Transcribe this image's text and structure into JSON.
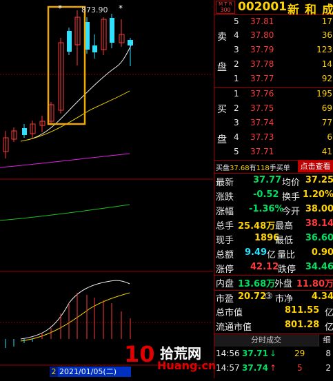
{
  "chart": {
    "high_label": "873.90",
    "star_marks": [
      "*",
      "*"
    ],
    "date_label": "2021/01/05(二)",
    "date_prefix": "2"
  },
  "header": {
    "logo_line1": "M T R",
    "logo_line2": "300",
    "code": "002001",
    "name": "新和成"
  },
  "sell": {
    "label_top": "卖",
    "label_bottom": "盘",
    "rows": [
      {
        "level": "5",
        "price": "37.81",
        "vol": "17"
      },
      {
        "level": "4",
        "price": "37.80",
        "vol": "36"
      },
      {
        "level": "3",
        "price": "37.79",
        "vol": "123"
      },
      {
        "level": "2",
        "price": "37.78",
        "vol": "14"
      },
      {
        "level": "1",
        "price": "37.77",
        "vol": "92"
      }
    ]
  },
  "buy": {
    "label_top": "买",
    "label_bottom": "盘",
    "rows": [
      {
        "level": "1",
        "price": "37.76",
        "vol": "195"
      },
      {
        "level": "2",
        "price": "37.75",
        "vol": "69"
      },
      {
        "level": "3",
        "price": "37.74",
        "vol": "77"
      },
      {
        "level": "4",
        "price": "37.73",
        "vol": "6"
      },
      {
        "level": "5",
        "price": "37.71",
        "vol": "41"
      }
    ]
  },
  "notice": {
    "prefix": "买盘",
    "price": "37.68",
    "mid": "有",
    "count": "118",
    "suffix": "手买单",
    "button": "点击查看"
  },
  "quote": {
    "latest_label": "最新",
    "latest": "37.77",
    "avg_label": "均价",
    "avg": "37.25",
    "change_label": "涨跌",
    "change": "-0.52",
    "turnover_label": "换手",
    "turnover": "1.20%",
    "pct_label": "涨幅",
    "pct": "-1.36%",
    "open_label": "今开",
    "open": "38.00",
    "volume_label": "总手",
    "volume": "25.48万",
    "high_label": "最高",
    "high": "38.14",
    "current_label": "现手",
    "current": "1896",
    "low_label": "最低",
    "low": "36.60",
    "amount_label": "总额",
    "amount": "9.49",
    "amount_unit": "亿",
    "ratio_label": "量比",
    "ratio": "0.90",
    "limit_up_label": "涨停",
    "limit_up": "42.12",
    "limit_down_label": "跌停",
    "limit_down": "34.46",
    "inner_label": "内盘",
    "inner": "13.68万",
    "outer_label": "外盘",
    "outer": "11.80万",
    "pe_label": "市盈",
    "pe": "20.72",
    "pe_badge": "③",
    "pb_label": "市净",
    "pb": "4.34",
    "mcap_label": "总市值",
    "mcap": "811.55",
    "mcap_unit": "亿",
    "float_label": "流通市值",
    "float": "801.28",
    "float_unit": "亿"
  },
  "ticks": {
    "tab_main": "分时成交",
    "tab_detail": "细",
    "rows": [
      {
        "time": "14:56",
        "price": "37.71",
        "arrow": "↓",
        "vol": "29",
        "count": "8"
      },
      {
        "time": "14:57",
        "price": "37.74",
        "arrow": "↑",
        "vol": "5",
        "count": "2"
      }
    ]
  },
  "watermark": {
    "number": "10",
    "brand": "拾荒网",
    "url": "Huang.cn"
  },
  "colors": {
    "up": "#ff3a3a",
    "down": "#00e060",
    "accent": "#ffd400",
    "frame": "#a00000",
    "highlight_box": "#f0a800"
  }
}
